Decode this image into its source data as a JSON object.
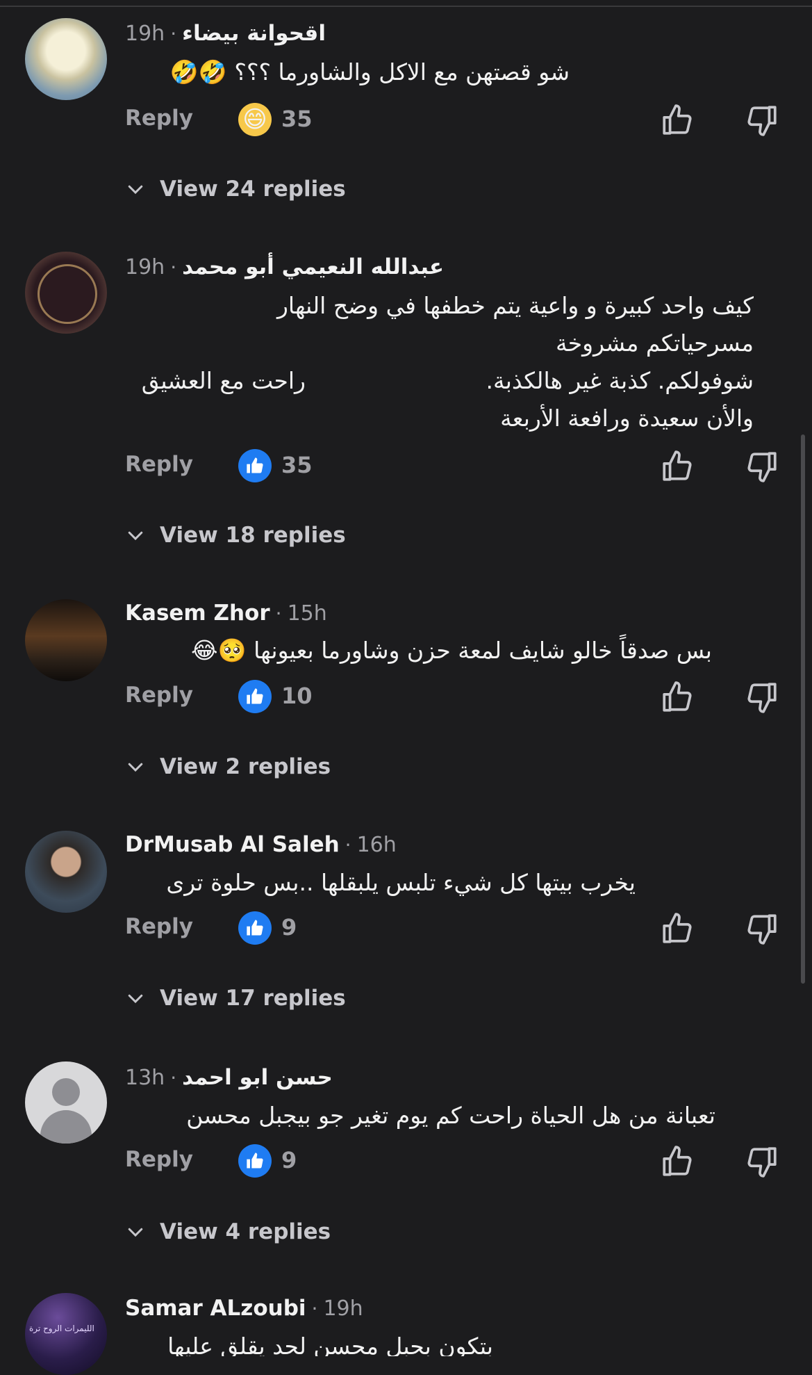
{
  "comments": [
    {
      "author": "اقحوانة  بيضاء",
      "time": "19h",
      "lines": [
        "شو قصتهن مع الاكل والشاورما ؟؟؟ 🤣🤣"
      ],
      "reply_label": "Reply",
      "reaction": "haha",
      "reaction_icon": "😄",
      "count": "35",
      "view_replies": "View 24 replies"
    },
    {
      "author": "عبدالله  النعيمي  أبو محمد",
      "time": "19h",
      "lines": [
        "كيف واحد كبيرة و واعية يتم خطفها في وضح النهار",
        "مسرحياتكم مشروخة",
        "شوفولكم. كذبة غير هالكذبة.",
        "والأن سعيدة ورافعة الأربعة"
      ],
      "extra_line": "راحت مع العشيق",
      "reply_label": "Reply",
      "reaction": "like",
      "count": "35",
      "view_replies": "View 18 replies"
    },
    {
      "author": "Kasem Zhor",
      "time": "15h",
      "lines": [
        "بس صدقاً خالو شايف لمعة حزن وشاورما بعيونها 🥺😂"
      ],
      "reply_label": "Reply",
      "reaction": "like",
      "count": "10",
      "view_replies": "View 2 replies"
    },
    {
      "author": "DrMusab Al Saleh",
      "time": "16h",
      "lines": [
        "يخرب بيتها كل شيء تلبس يلبقلها ..بس حلوة ترى"
      ],
      "reply_label": "Reply",
      "reaction": "like",
      "count": "9",
      "view_replies": "View 17 replies"
    },
    {
      "author": "حسن ابو احمد",
      "time": "13h",
      "lines": [
        "تعبانة من هل الحياة راحت كم يوم تغير جو بيجبل محسن"
      ],
      "reply_label": "Reply",
      "reaction": "like",
      "count": "9",
      "view_replies": "View 4 replies"
    },
    {
      "author": "Samar ALzoubi",
      "time": "19h",
      "lines": [
        "بتكون بحبل محسن لحد يقلق عليها"
      ],
      "avatar_text": "الليمرات الروح ترة"
    }
  ],
  "colors": {
    "background": "#1c1c1e",
    "like_blue": "#1f7cf2",
    "muted_text": "#a0a0a5"
  },
  "icons": {
    "like": "thumbs-up-icon",
    "dislike": "thumbs-down-icon",
    "expand": "chevron-down-icon"
  }
}
